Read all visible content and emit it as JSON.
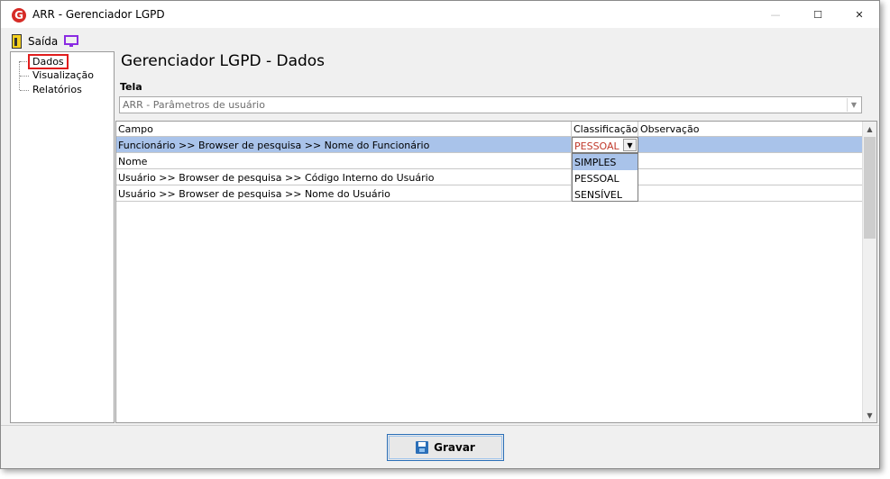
{
  "window": {
    "title": "ARR - Gerenciador LGPD",
    "logo_letter": "G",
    "minimize_glyph": "—",
    "maximize_glyph": "☐",
    "close_glyph": "✕"
  },
  "menu": {
    "exit_label": "Saída"
  },
  "tree": {
    "items": [
      {
        "label": "Dados",
        "selected": true
      },
      {
        "label": "Visualização"
      },
      {
        "label": "Relatórios"
      }
    ]
  },
  "main": {
    "title": "Gerenciador LGPD - Dados",
    "tela_label": "Tela",
    "tela_value": "ARR - Parâmetros de usuário",
    "dropdown_arrow": "▼"
  },
  "grid": {
    "headers": [
      "Campo",
      "Classificação",
      "Observação"
    ],
    "rows": [
      {
        "campo": "Funcionário >> Browser de pesquisa >> Nome do Funcionário",
        "classificacao": "PESSOAL",
        "observacao": ""
      },
      {
        "campo": "Nome",
        "classificacao": "",
        "observacao": ""
      },
      {
        "campo": "Usuário >> Browser de pesquisa >> Código Interno do Usuário",
        "classificacao": "",
        "observacao": ""
      },
      {
        "campo": "Usuário >> Browser de pesquisa >> Nome do Usuário",
        "classificacao": "",
        "observacao": ""
      }
    ],
    "editor_value": "PESSOAL",
    "options": [
      "SIMPLES",
      "PESSOAL",
      "SENSÍVEL"
    ],
    "highlighted_option": "SIMPLES",
    "scroll_up": "▲",
    "scroll_down": "▼"
  },
  "footer": {
    "save_label": "Gravar"
  },
  "colors": {
    "selection": "#a9c3ea",
    "highlight_red": "#e11d1d",
    "accent_blue": "#2b6fb8",
    "monitor_purple": "#8a2be2"
  },
  "icons": {
    "logo": "app-logo-icon",
    "exit": "exit-door-icon",
    "monitor": "monitor-icon",
    "save": "floppy-disk-icon"
  }
}
